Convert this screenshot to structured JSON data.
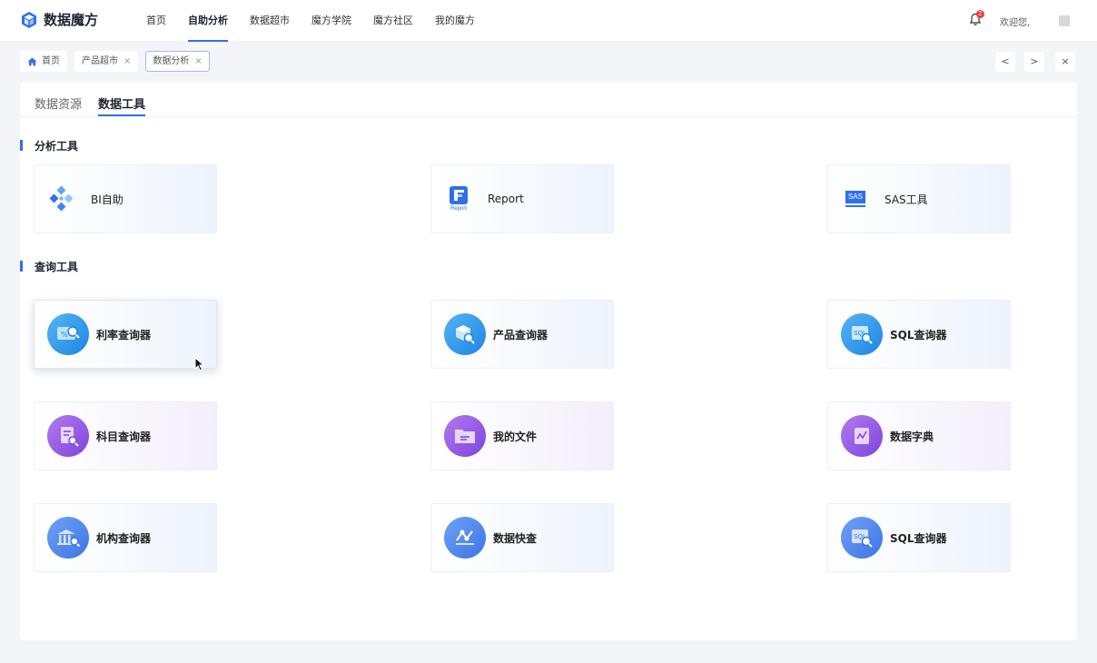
{
  "app": {
    "title": "数据魔方"
  },
  "nav": {
    "items": [
      {
        "label": "首页",
        "active": false
      },
      {
        "label": "自助分析",
        "active": true
      },
      {
        "label": "数据超市",
        "active": false
      },
      {
        "label": "魔方学院",
        "active": false
      },
      {
        "label": "魔方社区",
        "active": false
      },
      {
        "label": "我的魔方",
        "active": false
      }
    ]
  },
  "header": {
    "notification_count": "2",
    "welcome": "欢迎您,"
  },
  "breadcrumbs": [
    {
      "label": "首页",
      "closable": false,
      "active": false
    },
    {
      "label": "产品超市",
      "closable": true,
      "active": false
    },
    {
      "label": "数据分析",
      "closable": true,
      "active": true
    }
  ],
  "controls": {
    "prev": "<",
    "next": ">",
    "close": "×"
  },
  "subtabs": [
    {
      "label": "数据资源",
      "active": false
    },
    {
      "label": "数据工具",
      "active": true
    }
  ],
  "sections": {
    "analysis": {
      "title": "分析工具",
      "tools": [
        {
          "label": "BI自助",
          "icon": "bi-icon"
        },
        {
          "label": "Report",
          "icon": "report-icon",
          "icon_caption": "Report"
        },
        {
          "label": "SAS工具",
          "icon": "sas-icon",
          "icon_caption": "SAS"
        }
      ]
    },
    "query": {
      "title": "查询工具",
      "tools": [
        {
          "label": "利率查询器",
          "icon": "rate-search-icon",
          "color": "blue"
        },
        {
          "label": "产品查询器",
          "icon": "product-search-icon",
          "color": "blue"
        },
        {
          "label": "SQL查询器",
          "icon": "sql-search-icon",
          "color": "blue",
          "icon_caption": "SQL"
        },
        {
          "label": "科目查询器",
          "icon": "subject-search-icon",
          "color": "purple"
        },
        {
          "label": "我的文件",
          "icon": "folder-icon",
          "color": "purple"
        },
        {
          "label": "数据字典",
          "icon": "dictionary-icon",
          "color": "purple"
        },
        {
          "label": "机构查询器",
          "icon": "institution-search-icon",
          "color": "indigo"
        },
        {
          "label": "数据快查",
          "icon": "quick-query-icon",
          "color": "indigo"
        },
        {
          "label": "SQL查询器",
          "icon": "sql-search-icon",
          "color": "indigo",
          "icon_caption": "SQL"
        }
      ]
    }
  },
  "colors": {
    "accent": "#2f6fec",
    "badge": "#ee3b3b",
    "purple": "#7e44dc",
    "blue": "#1d86e3"
  }
}
